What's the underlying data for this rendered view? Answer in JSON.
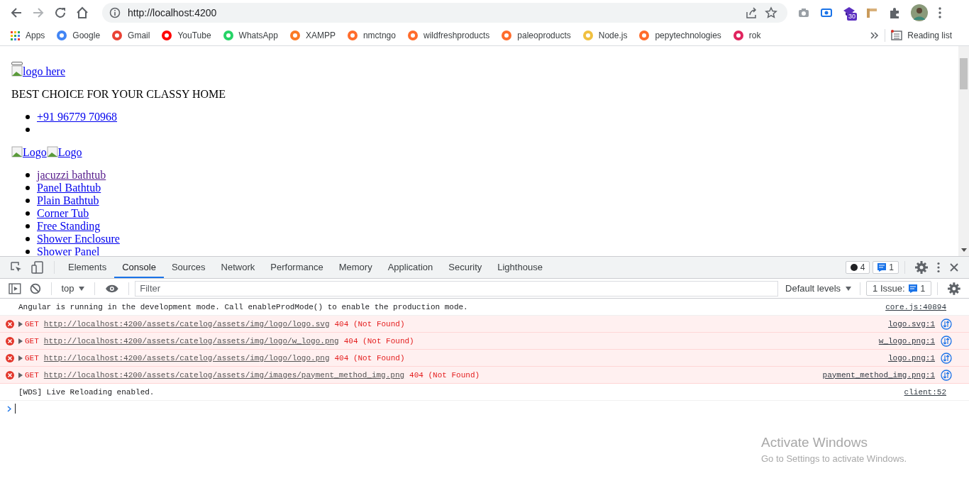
{
  "browser": {
    "address": "http://localhost:4200",
    "extension_badge": "30"
  },
  "bookmarks": [
    {
      "label": "Apps",
      "kind": "apps"
    },
    {
      "label": "Google",
      "kind": "site",
      "color": "#4285f4"
    },
    {
      "label": "Gmail",
      "kind": "site",
      "color": "#ea4335"
    },
    {
      "label": "YouTube",
      "kind": "site",
      "color": "#ff0000"
    },
    {
      "label": "WhatsApp",
      "kind": "site",
      "color": "#25d366"
    },
    {
      "label": "XAMPP",
      "kind": "site",
      "color": "#fb7a24"
    },
    {
      "label": "nmctngo",
      "kind": "site",
      "color": "#ff6c2c"
    },
    {
      "label": "wildfreshproducts",
      "kind": "site",
      "color": "#ff6c2c"
    },
    {
      "label": "paleoproducts",
      "kind": "site",
      "color": "#ff6c2c"
    },
    {
      "label": "Node.js",
      "kind": "site",
      "color": "#f0c040"
    },
    {
      "label": "pepytechnologies",
      "kind": "site",
      "color": "#ff6c2c"
    },
    {
      "label": "rok",
      "kind": "site",
      "color": "#e0245e"
    }
  ],
  "reading_list": "Reading list",
  "page": {
    "logo_link": "logo here",
    "tagline": "BEST CHOICE FOR YOUR CLASSY HOME",
    "contacts": [
      {
        "kind": "link",
        "text": "+91 96779 70968"
      },
      {
        "kind": "empty"
      }
    ],
    "logo_links": [
      "Logo",
      "Logo"
    ],
    "categories": [
      "jacuzzi bathtub",
      "Panel Bathtub",
      "Plain Bathtub",
      "Corner Tub",
      "Free Standing",
      "Shower Enclosure",
      "Shower Panel"
    ]
  },
  "devtools": {
    "tabs": [
      {
        "label": "Elements",
        "selected": false
      },
      {
        "label": "Console",
        "selected": true
      },
      {
        "label": "Sources",
        "selected": false
      },
      {
        "label": "Network",
        "selected": false
      },
      {
        "label": "Performance",
        "selected": false
      },
      {
        "label": "Memory",
        "selected": false
      },
      {
        "label": "Application",
        "selected": false
      },
      {
        "label": "Security",
        "selected": false
      },
      {
        "label": "Lighthouse",
        "selected": false
      }
    ],
    "error_count": "4",
    "issue_count": "1",
    "console_toolbar": {
      "context": "top",
      "filter_placeholder": "Filter",
      "levels": "Default levels",
      "issues_label": "1 Issue:",
      "issues_count": "1"
    },
    "messages": [
      {
        "kind": "info",
        "text": "Angular is running in the development mode. Call enableProdMode() to enable the production mode.",
        "source": "core.js:40894"
      },
      {
        "kind": "error",
        "method": "GET",
        "url": "http://localhost:4200/assets/catelog/assets/img/logo/logo.svg",
        "status": "404 (Not Found)",
        "source": "logo.svg:1"
      },
      {
        "kind": "error",
        "method": "GET",
        "url": "http://localhost:4200/assets/catelog/assets/img/logo/w_logo.png",
        "status": "404 (Not Found)",
        "source": "w_logo.png:1"
      },
      {
        "kind": "error",
        "method": "GET",
        "url": "http://localhost:4200/assets/catelog/assets/img/logo/logo.png",
        "status": "404 (Not Found)",
        "source": "logo.png:1"
      },
      {
        "kind": "error",
        "method": "GET",
        "url": "http://localhost:4200/assets/catelog/assets/img/images/payment_method_img.png",
        "status": "404 (Not Found)",
        "source": "payment_method_img.png:1"
      },
      {
        "kind": "info",
        "text": "[WDS] Live Reloading enabled.",
        "source": "client:52"
      }
    ]
  },
  "os_notice": {
    "title": "Activate Windows",
    "subtitle": "Go to Settings to activate Windows."
  }
}
